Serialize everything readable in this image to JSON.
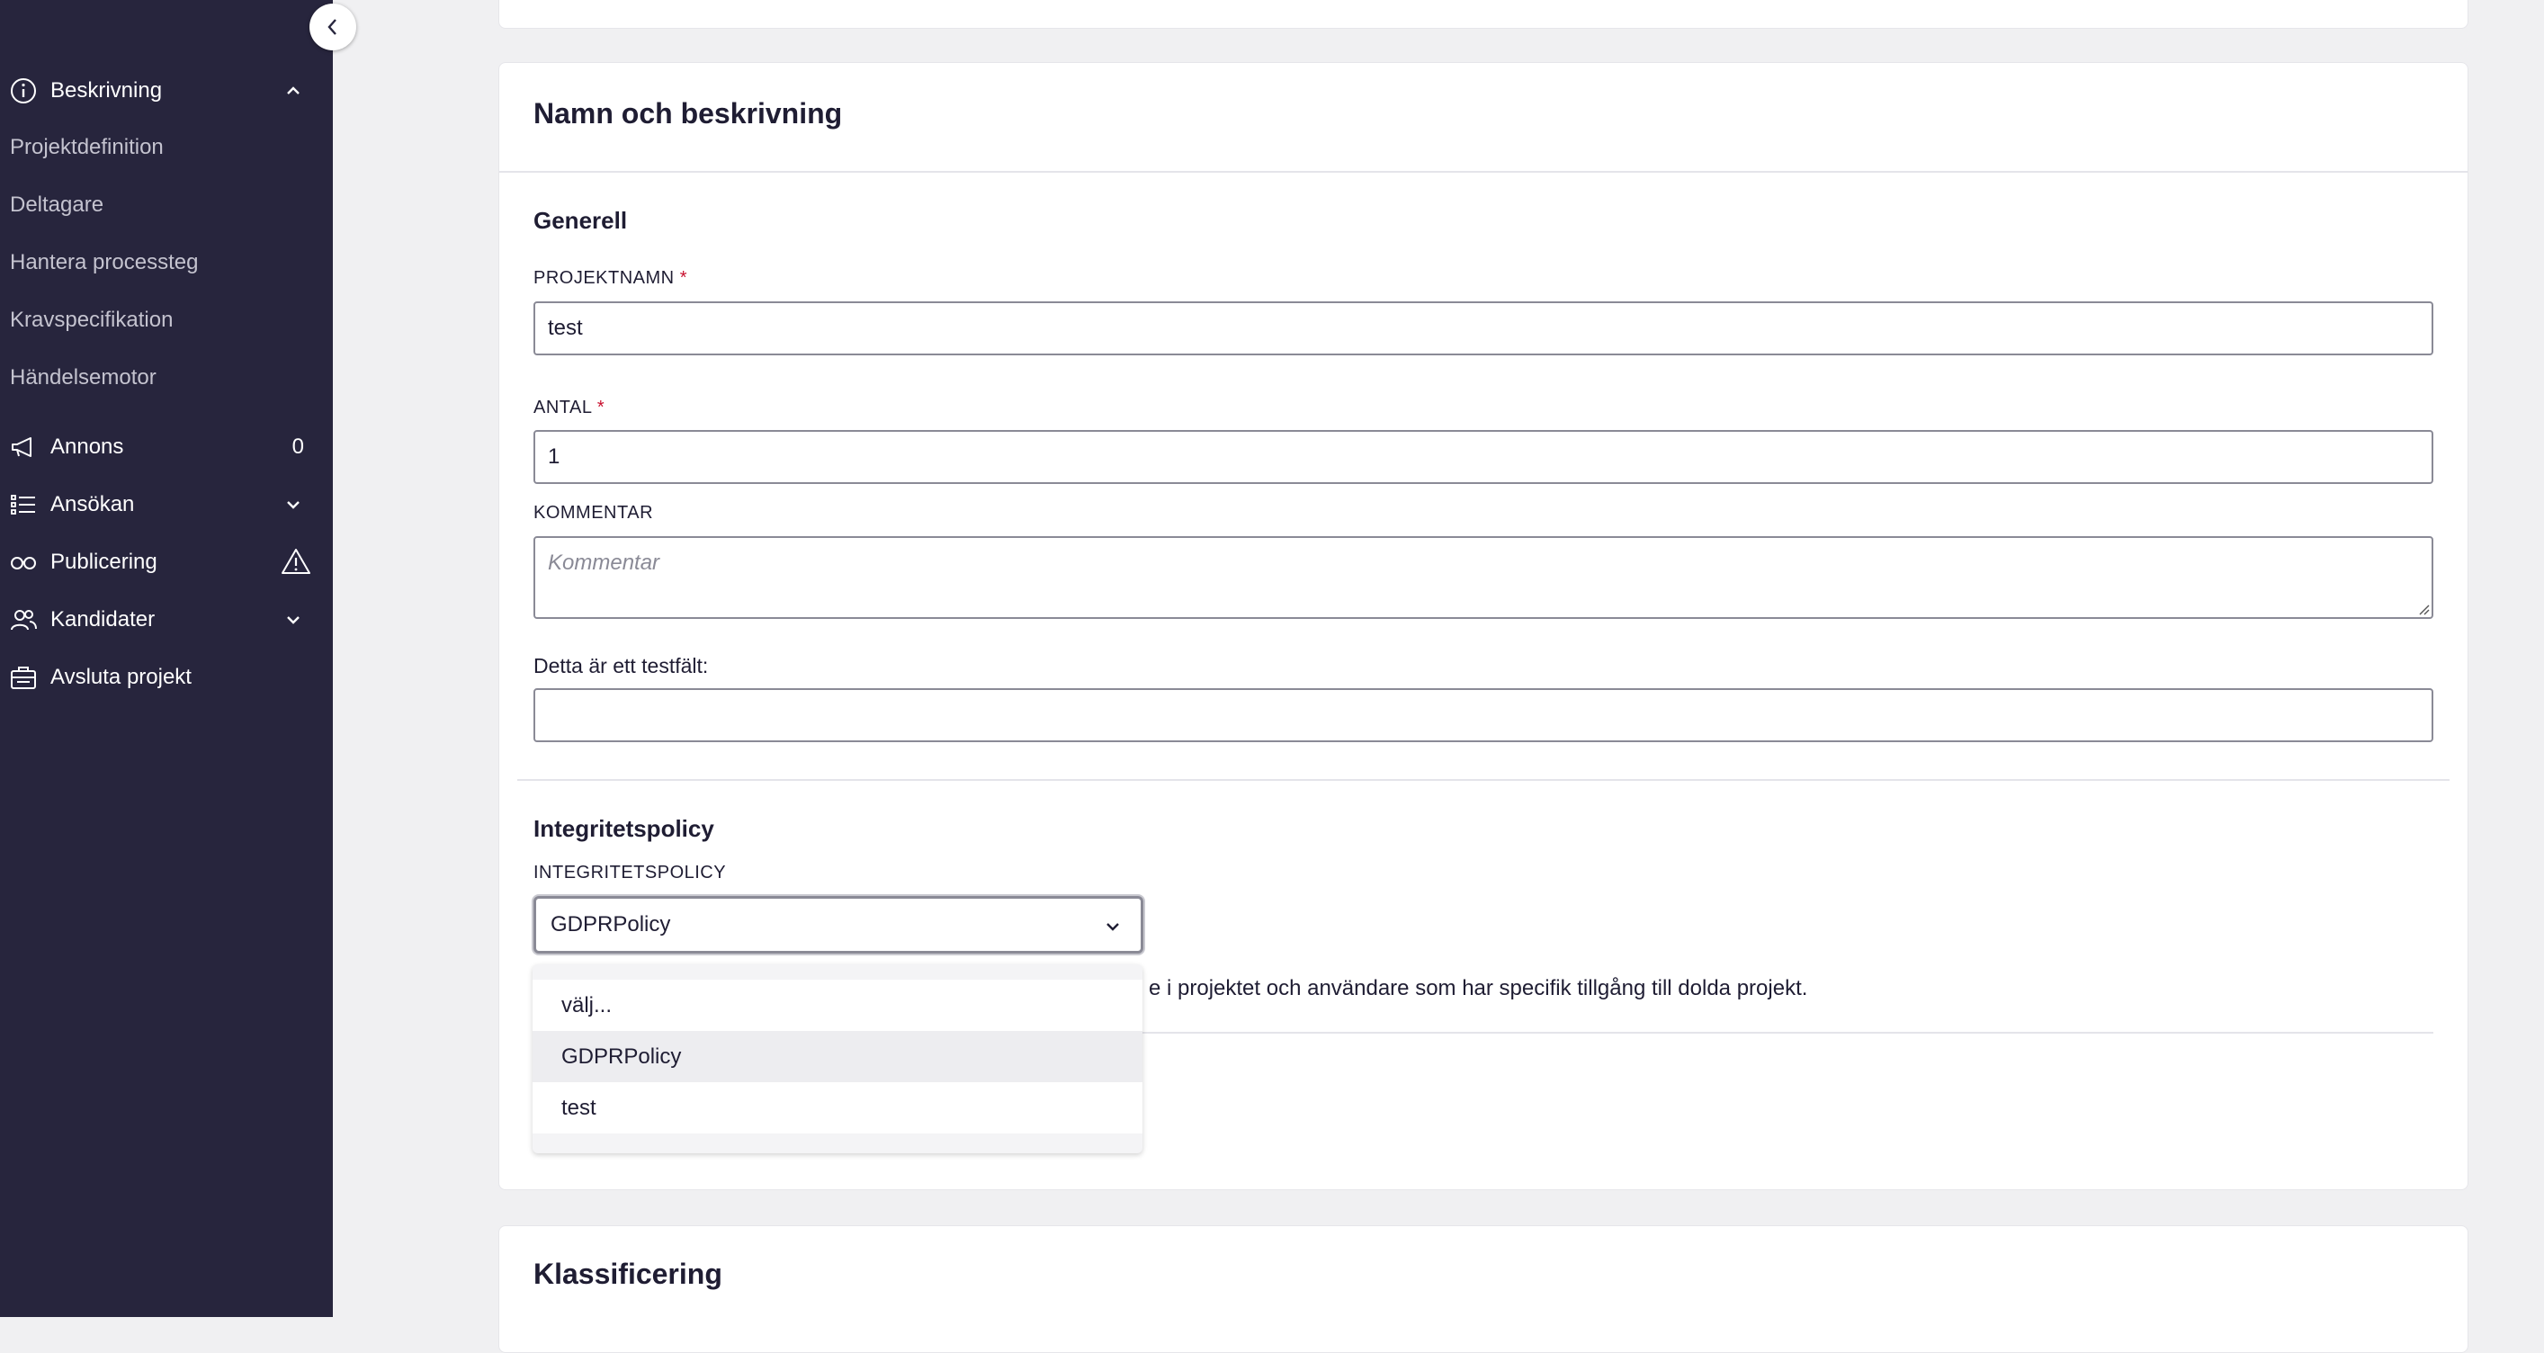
{
  "sidebar": {
    "collapse_icon": "chevron-left-icon",
    "beskrivning": {
      "label": "Beskrivning",
      "icon": "info-icon",
      "toggle_icon": "chevron-up-icon"
    },
    "sub_items": [
      {
        "label": "Projektdefinition"
      },
      {
        "label": "Deltagare"
      },
      {
        "label": "Hantera processteg"
      },
      {
        "label": "Kravspecifikation"
      },
      {
        "label": "Händelsemotor"
      }
    ],
    "annons": {
      "label": "Annons",
      "icon": "megaphone-icon",
      "count": "0"
    },
    "ansokan": {
      "label": "Ansökan",
      "icon": "list-icon",
      "toggle_icon": "chevron-down-icon"
    },
    "publicering": {
      "label": "Publicering",
      "icon": "glasses-icon",
      "status_icon": "warning-icon"
    },
    "kandidater": {
      "label": "Kandidater",
      "icon": "users-icon",
      "toggle_icon": "chevron-down-icon"
    },
    "avsluta": {
      "label": "Avsluta projekt",
      "icon": "briefcase-icon"
    }
  },
  "main": {
    "card_title": "Namn och beskrivning",
    "section_generell": "Generell",
    "projektnamn": {
      "label": "PROJEKTNAMN",
      "required_mark": "*",
      "value": "test"
    },
    "antal": {
      "label": "ANTAL",
      "required_mark": "*",
      "value": "1"
    },
    "kommentar": {
      "label": "KOMMENTAR",
      "placeholder": "Kommentar"
    },
    "testfalt": {
      "label": "Detta är ett testfält:",
      "value": ""
    },
    "section_integritet": "Integritetspolicy",
    "integritetspolicy": {
      "label": "INTEGRITETSPOLICY",
      "selected": "GDPRPolicy",
      "helper_text_visible": "e i projektet och användare som har specifik tillgång till dolda projekt.",
      "options": [
        {
          "label": "välj..."
        },
        {
          "label": "GDPRPolicy"
        },
        {
          "label": "test"
        }
      ]
    },
    "klassificering_title": "Klassificering"
  },
  "colors": {
    "sidebar_bg": "#27253d",
    "page_bg": "#f0f0f2",
    "required": "#c8102e",
    "text": "#1f1d33"
  }
}
